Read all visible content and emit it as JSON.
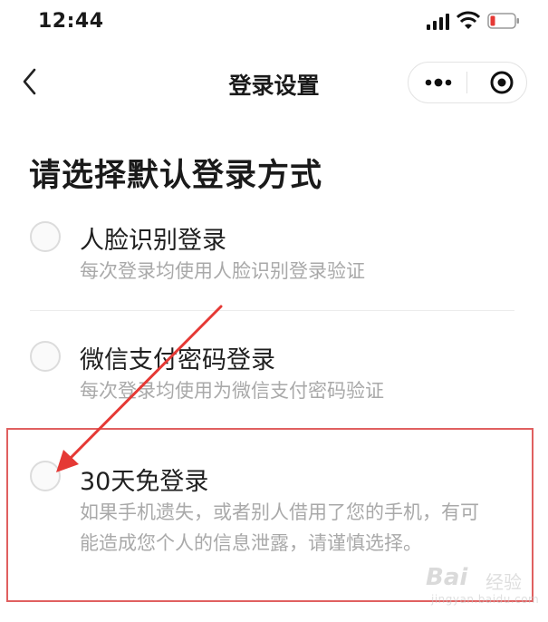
{
  "status_bar": {
    "time": "12:44"
  },
  "nav": {
    "title": "登录设置"
  },
  "section_title": "请选择默认登录方式",
  "options": [
    {
      "label": "人脸识别登录",
      "description": "每次登录均使用人脸识别登录验证"
    },
    {
      "label": "微信支付密码登录",
      "description": "每次登录均使用为微信支付密码验证"
    },
    {
      "label": "30天免登录",
      "description": "如果手机遗失，或者别人借用了您的手机，有可能造成您个人的信息泄露，请谨慎选择。"
    }
  ],
  "watermark": {
    "brand": "Bai",
    "brand2": "经验",
    "url": "jingyan.baidu.com"
  },
  "colors": {
    "highlight_border": "#e06060",
    "arrow": "#e53935"
  }
}
